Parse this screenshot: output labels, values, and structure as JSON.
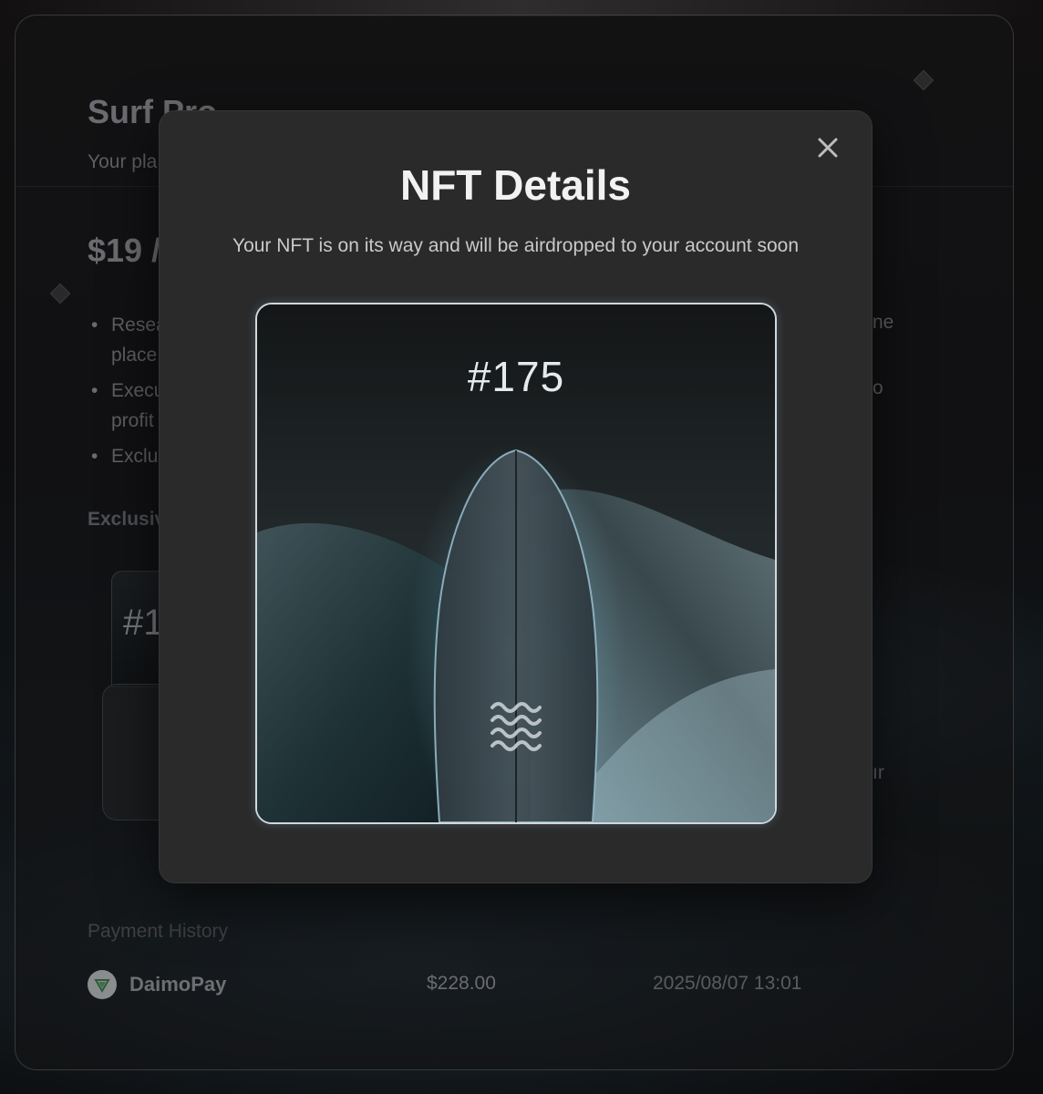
{
  "background": {
    "plan_title": "Surf Pro",
    "plan_subtitle": "Your pla",
    "price": "$19 /",
    "features": [
      {
        "left": "Resea",
        "left2": "place",
        "right": "ne"
      },
      {
        "left": "Execu",
        "left2": "profit",
        "right": "o"
      },
      {
        "left": "Exclu",
        "left2": "",
        "right": ""
      }
    ],
    "exclusive_label": "Exclusiv",
    "nft_preview_number": "#1",
    "right_fragment": "ır",
    "payment_history": {
      "label": "Payment History",
      "rows": [
        {
          "provider": "DaimoPay",
          "amount": "$228.00",
          "date": "2025/08/07 13:01"
        }
      ]
    }
  },
  "modal": {
    "title": "NFT Details",
    "subtitle": "Your NFT is on its way and will be airdropped to your account soon",
    "close_label": "×",
    "nft": {
      "number": "#175",
      "icon": "waves-icon"
    }
  },
  "colors": {
    "modal_bg": "#2a2a2b",
    "nft_border": "#cfd8de",
    "accent_teal": "#6fa3b4"
  }
}
